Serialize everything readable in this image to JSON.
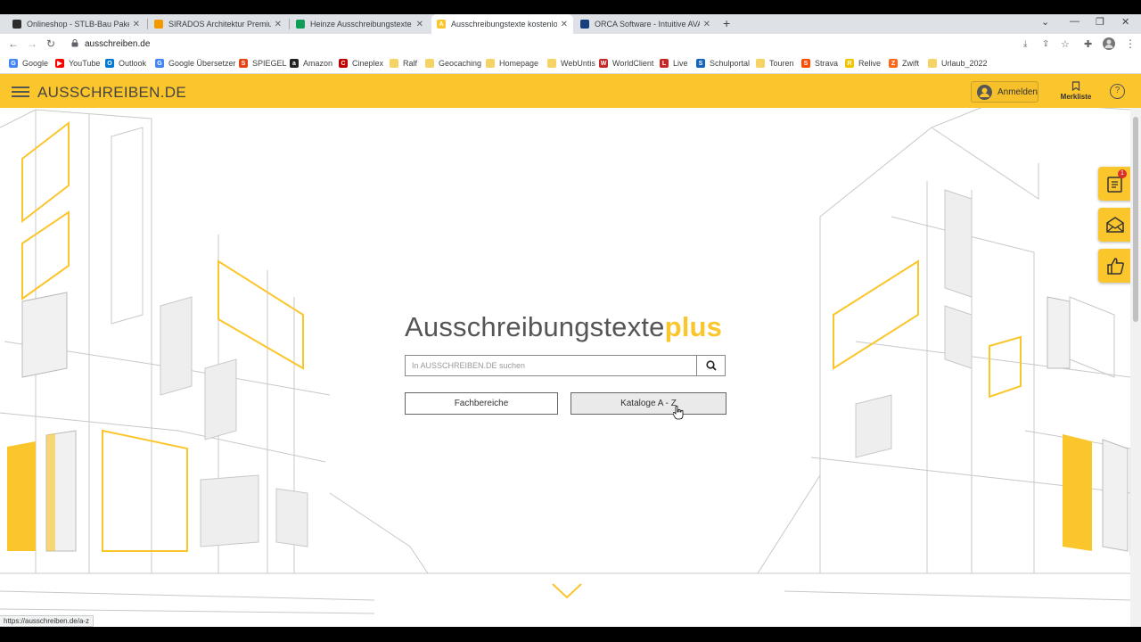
{
  "browser": {
    "tabs": [
      {
        "title": "Onlineshop - STLB-Bau Pakete ka",
        "favicon_color": "#2d2d2d",
        "favicon_letter": "S",
        "active": false
      },
      {
        "title": "SIRADOS Architektur Premium",
        "favicon_color": "#f29900",
        "favicon_letter": "",
        "active": false
      },
      {
        "title": "Heinze Ausschreibungstexte onli",
        "favicon_color": "#0f9d58",
        "favicon_letter": "",
        "active": false
      },
      {
        "title": "Ausschreibungstexte kostenlos a",
        "favicon_color": "#fbc52c",
        "favicon_letter": "A",
        "active": true
      },
      {
        "title": "ORCA Software - Intuitive AVA &",
        "favicon_color": "#1a3d7c",
        "favicon_letter": "",
        "active": false
      }
    ],
    "new_tab": "+",
    "url": "ausschreiben.de",
    "bookmarks": [
      {
        "label": "Google",
        "color": "#4285f4",
        "letter": "G"
      },
      {
        "label": "YouTube",
        "color": "#ff0000",
        "letter": "▶"
      },
      {
        "label": "Outlook",
        "color": "#0078d4",
        "letter": "O"
      },
      {
        "label": "Google Übersetzer",
        "color": "#4285f4",
        "letter": "G"
      },
      {
        "label": "SPIEGEL",
        "color": "#e64415",
        "letter": "S"
      },
      {
        "label": "Amazon",
        "color": "#222222",
        "letter": "a"
      },
      {
        "label": "Cineplex",
        "color": "#c00000",
        "letter": "C"
      },
      {
        "label": "Ralf",
        "color": "#f6d365",
        "letter": ""
      },
      {
        "label": "Geocaching",
        "color": "#f6d365",
        "letter": ""
      },
      {
        "label": "Homepage",
        "color": "#f6d365",
        "letter": ""
      },
      {
        "label": "WebUntis",
        "color": "#f6d365",
        "letter": ""
      },
      {
        "label": "WorldClient",
        "color": "#c62828",
        "letter": "W"
      },
      {
        "label": "Live",
        "color": "#c62828",
        "letter": "L"
      },
      {
        "label": "Schulportal",
        "color": "#1565c0",
        "letter": "S"
      },
      {
        "label": "Touren",
        "color": "#f6d365",
        "letter": ""
      },
      {
        "label": "Strava",
        "color": "#fc4c02",
        "letter": "S"
      },
      {
        "label": "Relive",
        "color": "#f5c400",
        "letter": "R"
      },
      {
        "label": "Zwift",
        "color": "#fc6719",
        "letter": "Z"
      },
      {
        "label": "Urlaub_2022",
        "color": "#f6d365",
        "letter": ""
      }
    ],
    "status_url": "https://ausschreiben.de/a-z"
  },
  "header": {
    "logo": "AUSSCHREIBEN.DE",
    "login_label": "Anmelden",
    "merkliste_label": "Merkliste",
    "help": "?"
  },
  "side": {
    "badge_count": "1"
  },
  "hero": {
    "title_main": "Ausschreibungstexte",
    "title_plus": "plus",
    "search_placeholder": "In AUSSCHREIBEN.DE suchen",
    "btn_fachbereiche": "Fachbereiche",
    "btn_kataloge": "Kataloge A - Z"
  },
  "colors": {
    "brand_yellow": "#fbc52c",
    "text_grey": "#555555"
  }
}
